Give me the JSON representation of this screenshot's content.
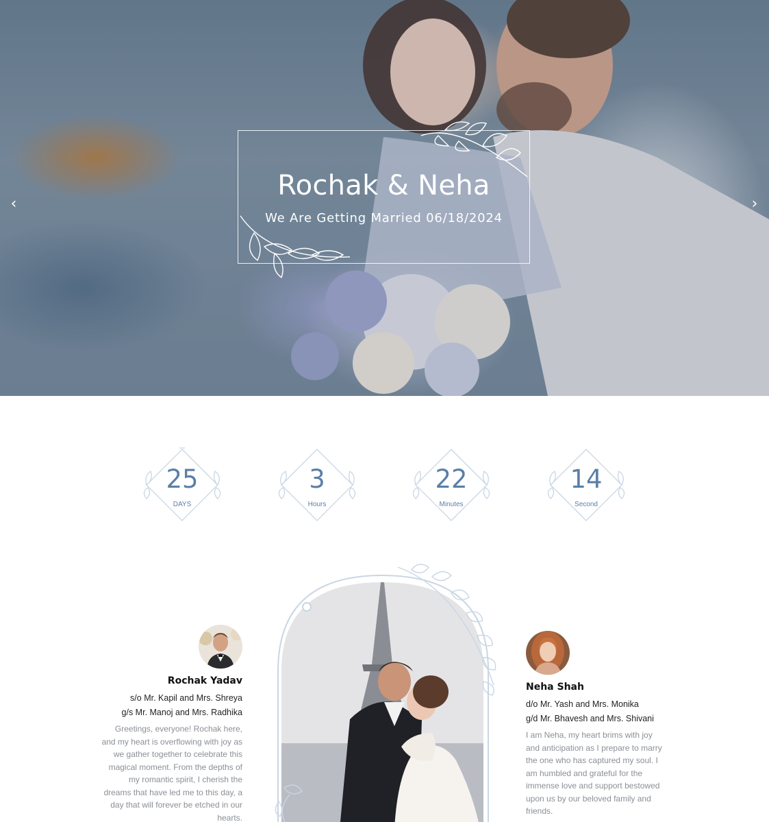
{
  "hero": {
    "title": "Rochak & Neha",
    "subtitle": "We Are Getting Married 06/18/2024",
    "prev_icon": "chevron-left-icon",
    "next_icon": "chevron-right-icon"
  },
  "countdown": [
    {
      "value": "25",
      "label": "DAYS"
    },
    {
      "value": "3",
      "label": "Hours"
    },
    {
      "value": "22",
      "label": "Minutes"
    },
    {
      "value": "14",
      "label": "Second"
    }
  ],
  "groom": {
    "name": "Rochak Yadav",
    "parents": "s/o Mr. Kapil and Mrs. Shreya",
    "grandparents": "g/s Mr. Manoj and Mrs. Radhika",
    "bio": "Greetings, everyone! Rochak here, and my heart is overflowing with joy as we gather together to celebrate this magical moment. From the depths of my romantic spirit, I cherish the dreams that have led me to this day, a day that will forever be etched in our hearts."
  },
  "bride": {
    "name": "Neha Shah",
    "parents": "d/o Mr. Yash and Mrs. Monika",
    "grandparents": "g/d Mr. Bhavesh and Mrs. Shivani",
    "bio": "I am Neha, my heart brims with joy and anticipation as I prepare to marry the one who has captured my soul. I am humbled and grateful for the immense love and support bestowed upon us by our beloved family and friends."
  },
  "colors": {
    "accent": "#5b7fa6",
    "frame": "#c9d6e4",
    "muted_text": "#8a8f96"
  }
}
